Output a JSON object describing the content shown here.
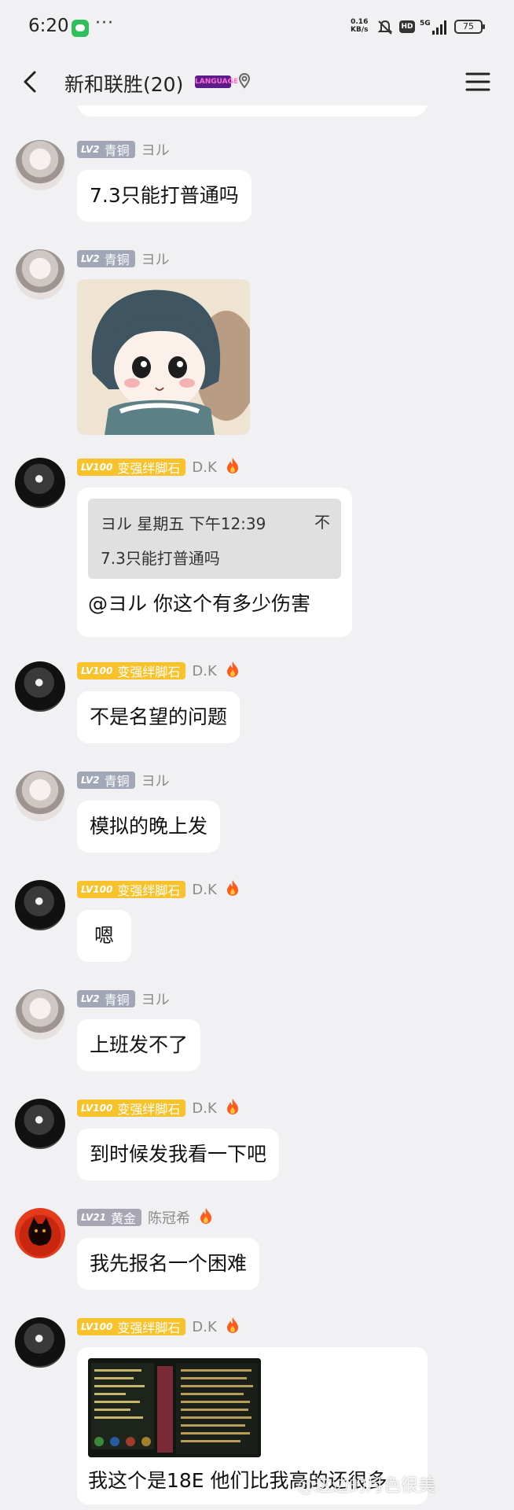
{
  "status_bar": {
    "time": "6:20",
    "net_speed_value": "0.16",
    "net_speed_unit": "KB/s",
    "hd": "HD",
    "network": "5G",
    "battery": "75"
  },
  "header": {
    "title": "新和联胜(20)",
    "badge": "LANGUAGE",
    "back_icon": "back-arrow-icon",
    "menu_icon": "hamburger-menu-icon"
  },
  "messages": [
    {
      "level": "LV2",
      "rank": "青铜",
      "sender": "ヨル",
      "text": "7.3只能打普通吗"
    },
    {
      "level": "LV2",
      "rank": "青铜",
      "sender": "ヨル",
      "type": "sticker"
    },
    {
      "level": "LV100",
      "rank": "变强绊脚石",
      "sender": "D.K",
      "type": "quote",
      "quote_header": "ヨル 星期五 下午12:39",
      "quote_close": "不",
      "quote_text": "7.3只能打普通吗",
      "text": "@ヨル 你这个有多少伤害"
    },
    {
      "level": "LV100",
      "rank": "变强绊脚石",
      "sender": "D.K",
      "text": "不是名望的问题"
    },
    {
      "level": "LV2",
      "rank": "青铜",
      "sender": "ヨル",
      "text": "模拟的晚上发"
    },
    {
      "level": "LV100",
      "rank": "变强绊脚石",
      "sender": "D.K",
      "text": "嗯"
    },
    {
      "level": "LV2",
      "rank": "青铜",
      "sender": "ヨル",
      "text": "上班发不了"
    },
    {
      "level": "LV100",
      "rank": "变强绊脚石",
      "sender": "D.K",
      "text": "到时候发我看一下吧"
    },
    {
      "level": "LV21",
      "rank": "黄金",
      "sender": "陈冠希",
      "text": "我先报名一个困难"
    },
    {
      "level": "LV100",
      "rank": "变强绊脚石",
      "sender": "D.K",
      "type": "image",
      "text": "我这个是18E  他们比我高的还很多"
    }
  ],
  "watermark": "@这边的月色很美",
  "colors": {
    "background": "#f1f1f3",
    "bubble": "#ffffff",
    "lv_gold": "#f7c22c",
    "lv_gray": "#a2a7b8"
  }
}
